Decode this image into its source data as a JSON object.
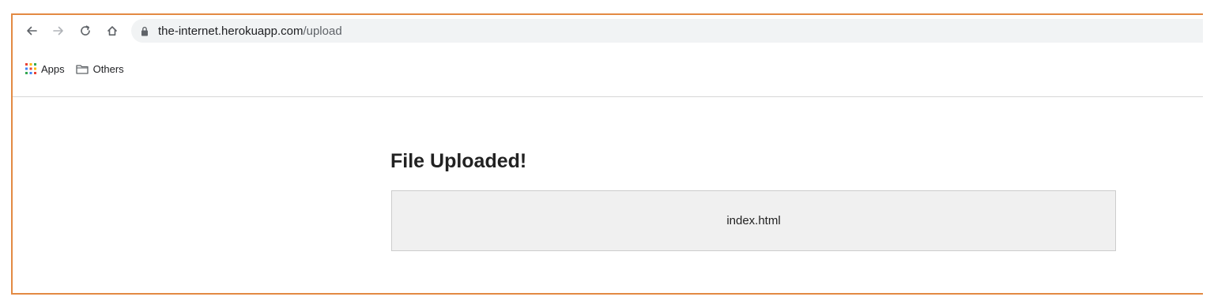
{
  "browser": {
    "url_host": "the-internet.herokuapp.com",
    "url_path": "/upload",
    "icons": {
      "back": "arrow-left-icon",
      "forward": "arrow-right-icon",
      "reload": "reload-icon",
      "home": "home-icon",
      "lock": "lock-icon"
    }
  },
  "bookmarks": [
    {
      "label": "Apps",
      "icon": "apps-grid-icon"
    },
    {
      "label": "Others",
      "icon": "folder-icon"
    }
  ],
  "page": {
    "heading": "File Uploaded!",
    "uploaded_file": "index.html"
  },
  "colors": {
    "frame_border": "#e38a43",
    "omnibox_bg": "#f1f3f4",
    "file_box_bg": "#f0f0f0"
  }
}
